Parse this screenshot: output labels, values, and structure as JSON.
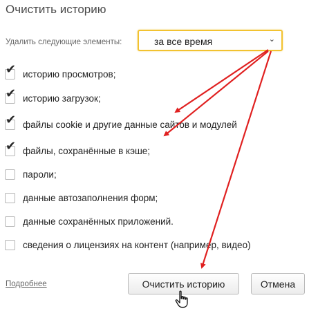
{
  "dialog": {
    "title": "Очистить историю",
    "range_label": "Удалить следующие элементы:",
    "range_select": {
      "value": "за все время",
      "chevron_icon": "chevron-down-icon"
    },
    "items": [
      {
        "label": "историю просмотров;",
        "checked": true
      },
      {
        "label": "историю загрузок;",
        "checked": true
      },
      {
        "label": "файлы cookie и другие данные сайтов и модулей",
        "checked": true
      },
      {
        "label": "файлы, сохранённые в кэше;",
        "checked": true
      },
      {
        "label": "пароли;",
        "checked": false
      },
      {
        "label": "данные автозаполнения форм;",
        "checked": false
      },
      {
        "label": "данные сохранённых приложений.",
        "checked": false
      },
      {
        "label": "сведения о лицензиях на контент (например, видео)",
        "checked": false
      }
    ],
    "more_link": "Подробнее",
    "clear_button": "Очистить историю",
    "cancel_button": "Отмена"
  },
  "annotation": {
    "arrow_color": "#e02020"
  },
  "colors": {
    "select_border": "#f2c230",
    "text": "#222222",
    "muted": "#666666"
  }
}
